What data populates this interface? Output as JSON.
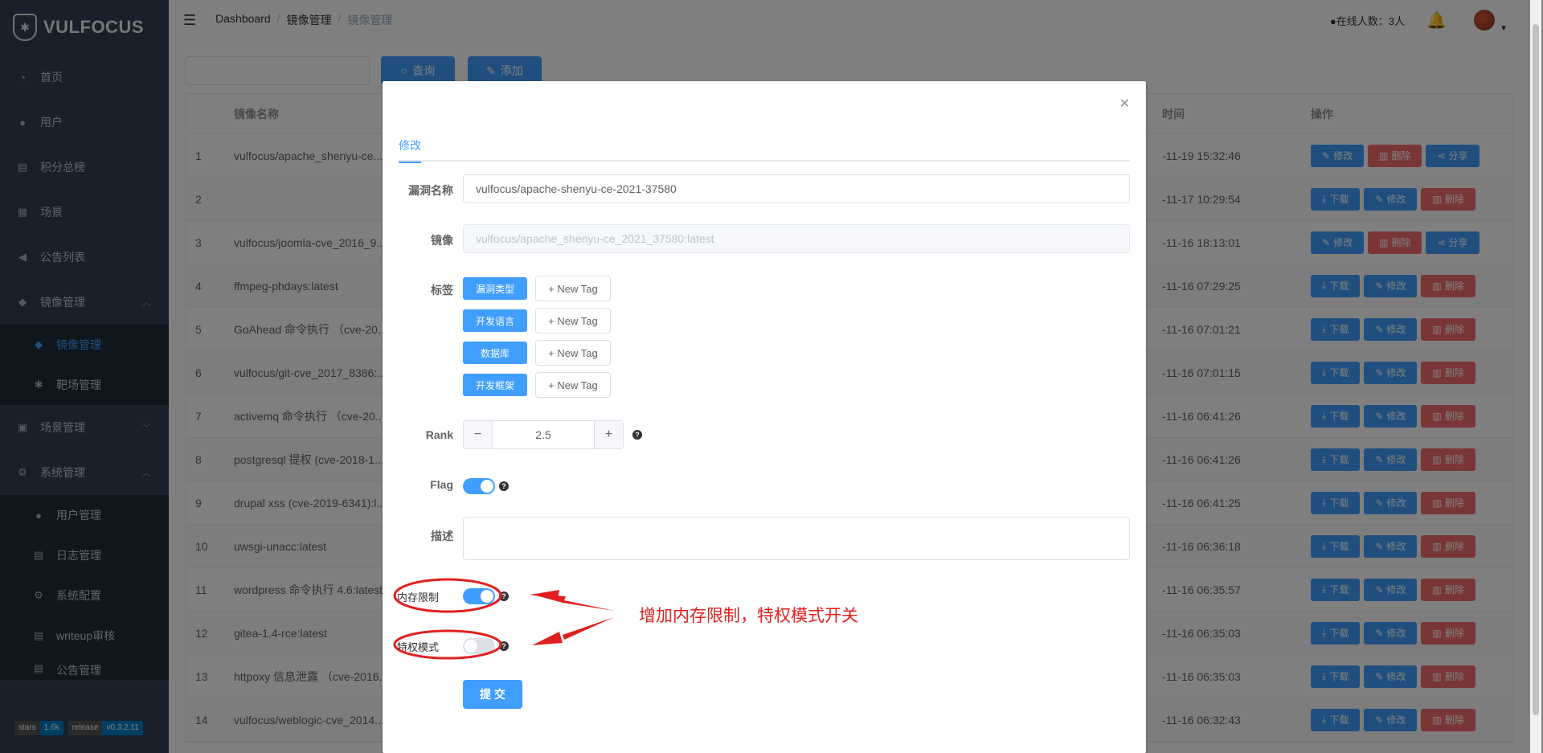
{
  "sidebar": {
    "logo": "VULFOCUS",
    "items": [
      {
        "label": "首页",
        "icon": "dashboard-icon"
      },
      {
        "label": "用户",
        "icon": "user-icon"
      },
      {
        "label": "积分总榜",
        "icon": "ranking-icon"
      },
      {
        "label": "场景",
        "icon": "grid-icon"
      },
      {
        "label": "公告列表",
        "icon": "megaphone-icon"
      },
      {
        "label": "镜像管理",
        "icon": "docker-icon"
      }
    ],
    "image_sub": [
      {
        "label": "镜像管理",
        "icon": "docker-icon"
      },
      {
        "label": "靶场管理",
        "icon": "bug-icon"
      }
    ],
    "scene_mgmt": {
      "label": "场景管理",
      "icon": "scene-icon"
    },
    "system_mgmt": {
      "label": "系统管理",
      "icon": "settings-icon"
    },
    "system_sub": [
      {
        "label": "用户管理",
        "icon": "user-icon"
      },
      {
        "label": "日志管理",
        "icon": "log-icon"
      },
      {
        "label": "系统配置",
        "icon": "gear-icon"
      },
      {
        "label": "writeup审核",
        "icon": "document-icon"
      },
      {
        "label": "公告管理",
        "icon": "notice-icon"
      }
    ],
    "badges": [
      {
        "k": "stars",
        "v": "1.6k"
      },
      {
        "k": "release",
        "v": "v0.3.2.11"
      }
    ]
  },
  "navbar": {
    "breadcrumb": [
      "Dashboard",
      "镜像管理",
      "镜像管理"
    ],
    "online": "在线人数：3人"
  },
  "toolbar": {
    "search_label": "查询",
    "add_label": "添加"
  },
  "table": {
    "headers": {
      "name": "镜像名称",
      "time": "时间",
      "ops": "操作"
    },
    "rows": [
      {
        "idx": "1",
        "name": "vulfocus/apache_shenyu-ce...",
        "time": "-11-19 15:32:46",
        "ops": [
          "修改",
          "删除",
          "分享"
        ]
      },
      {
        "idx": "2",
        "name": "",
        "time": "-11-17 10:29:54",
        "ops": [
          "下载",
          "修改",
          "删除"
        ]
      },
      {
        "idx": "3",
        "name": "vulfocus/joomla-cve_2016_9...",
        "time": "-11-16 18:13:01",
        "ops": [
          "修改",
          "删除",
          "分享"
        ]
      },
      {
        "idx": "4",
        "name": "ffmpeg-phdays:latest",
        "time": "-11-16 07:29:25",
        "ops": [
          "下载",
          "修改",
          "删除"
        ]
      },
      {
        "idx": "5",
        "name": "GoAhead 命令执行 （cve-20...",
        "time": "-11-16 07:01:21",
        "ops": [
          "下载",
          "修改",
          "删除"
        ]
      },
      {
        "idx": "6",
        "name": "vulfocus/git-cve_2017_8386:...",
        "time": "-11-16 07:01:15",
        "ops": [
          "下载",
          "修改",
          "删除"
        ]
      },
      {
        "idx": "7",
        "name": "activemq 命令执行 （cve-20...",
        "time": "-11-16 06:41:26",
        "ops": [
          "下载",
          "修改",
          "删除"
        ]
      },
      {
        "idx": "8",
        "name": "postgresql 提权 (cve-2018-1...",
        "time": "-11-16 06:41:26",
        "ops": [
          "下载",
          "修改",
          "删除"
        ]
      },
      {
        "idx": "9",
        "name": "drupal xss (cve-2019-6341):l...",
        "time": "-11-16 06:41:25",
        "ops": [
          "下载",
          "修改",
          "删除"
        ]
      },
      {
        "idx": "10",
        "name": "uwsgi-unacc:latest",
        "time": "-11-16 06:36:18",
        "ops": [
          "下载",
          "修改",
          "删除"
        ]
      },
      {
        "idx": "11",
        "name": "wordpress 命令执行 4.6:latest",
        "time": "-11-16 06:35:57",
        "ops": [
          "下载",
          "修改",
          "删除"
        ]
      },
      {
        "idx": "12",
        "name": "gitea-1.4-rce:latest",
        "time": "-11-16 06:35:03",
        "ops": [
          "下载",
          "修改",
          "删除"
        ]
      },
      {
        "idx": "13",
        "name": "httpoxy 信息泄露 （cve-2016...",
        "time": "-11-16 06:35:03",
        "ops": [
          "下载",
          "修改",
          "删除"
        ]
      },
      {
        "idx": "14",
        "name": "vulfocus/weblogic-cve_2014...",
        "time": "-11-16 06:32:43",
        "ops": [
          "下载",
          "修改",
          "删除"
        ]
      }
    ]
  },
  "dialog": {
    "tab": "修改",
    "vuln_name_label": "漏洞名称",
    "vuln_name_value": "vulfocus/apache-shenyu-ce-2021-37580",
    "image_label": "镜像",
    "image_value": "vulfocus/apache_shenyu-ce_2021_37580:latest",
    "tags_label": "标签",
    "tags": [
      "漏洞类型",
      "开发语言",
      "数据库",
      "开发框架"
    ],
    "new_tag": "+ New Tag",
    "rank_label": "Rank",
    "rank_value": "2.5",
    "flag_label": "Flag",
    "flag_on": true,
    "desc_label": "描述",
    "memory_label": "内存限制",
    "memory_on": true,
    "privileged_label": "特权模式",
    "privileged_on": false,
    "submit": "提 交"
  },
  "annotation": {
    "text": "增加内存限制，特权模式开关",
    "color": "#e02020"
  },
  "colors": {
    "primary": "#409eff",
    "danger": "#f56c6c",
    "sidebar": "#304156"
  }
}
